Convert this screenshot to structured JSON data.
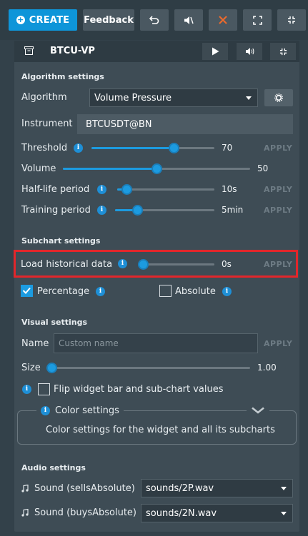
{
  "toolbar": {
    "create_label": "CREATE",
    "feedback_label": "Feedback"
  },
  "widget": {
    "title": "BTCU-VP"
  },
  "algorithm_settings": {
    "heading": "Algorithm settings",
    "algorithm_label": "Algorithm",
    "algorithm_value": "Volume Pressure",
    "instrument_label": "Instrument",
    "instrument_value": "BTCUSDT@BN",
    "threshold": {
      "label": "Threshold",
      "value": "70",
      "level": 0.67,
      "apply": "APPLY"
    },
    "volume": {
      "label": "Volume",
      "value": "50",
      "level": 0.5
    },
    "half_life": {
      "label": "Half-life period",
      "value": "10s",
      "level": 0.1,
      "apply": "APPLY"
    },
    "training": {
      "label": "Training period",
      "value": "5min",
      "level": 0.23,
      "apply": "APPLY"
    }
  },
  "subchart_settings": {
    "heading": "Subchart settings",
    "load_historical": {
      "label": "Load historical data",
      "value": "0s",
      "level": 0.0,
      "apply": "APPLY"
    },
    "percentage_label": "Percentage",
    "percentage_checked": true,
    "absolute_label": "Absolute",
    "absolute_checked": false
  },
  "visual_settings": {
    "heading": "Visual settings",
    "name_label": "Name",
    "name_placeholder": "Custom name",
    "name_apply": "APPLY",
    "size": {
      "label": "Size",
      "value": "1.00",
      "level": 0.0
    },
    "flip_label": "Flip widget bar and sub-chart values",
    "flip_checked": false,
    "color_settings_label": "Color settings",
    "color_settings_desc": "Color settings for the widget and all its subcharts"
  },
  "audio_settings": {
    "heading": "Audio settings",
    "sells_label": "Sound (sellsAbsolute)",
    "sells_value": "sounds/2P.wav",
    "buys_label": "Sound (buysAbsolute)",
    "buys_value": "sounds/2N.wav"
  },
  "colors": {
    "accent": "#1c9be0",
    "create_button": "#0e95d9",
    "close_icon": "#f26a2a",
    "highlight_border": "#e2262b"
  },
  "icons": [
    "plus-circle-icon",
    "undo-icon",
    "mute-icon",
    "close-icon",
    "expand-icon",
    "compress-icon",
    "archive-icon",
    "play-icon",
    "volume-icon",
    "gear-icon",
    "info-icon",
    "chevron-down-icon",
    "music-note-icon"
  ]
}
